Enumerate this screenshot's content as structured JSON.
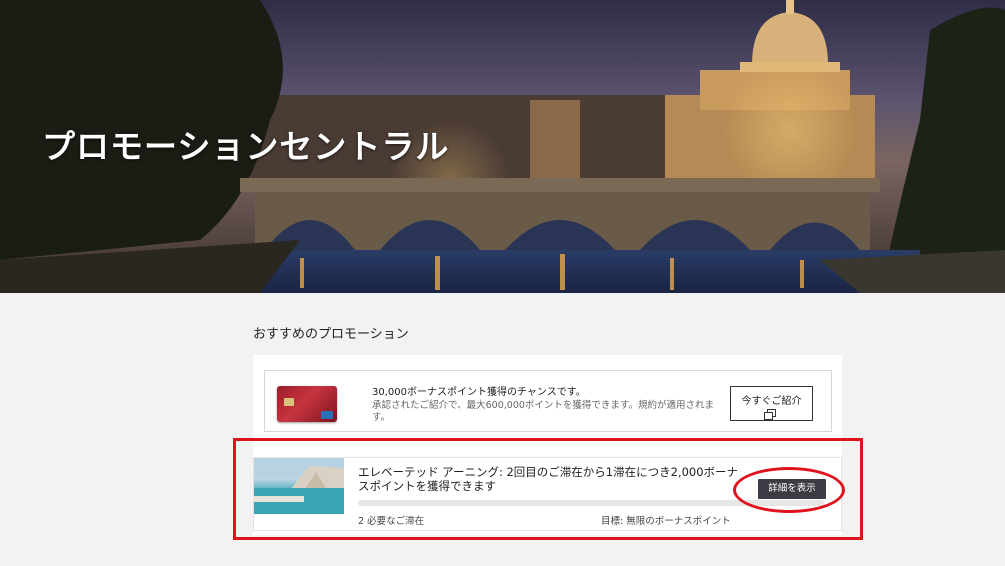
{
  "hero": {
    "title": "プロモーションセントラル"
  },
  "section": {
    "title": "おすすめのプロモーション"
  },
  "promotions": [
    {
      "title": "30,000ボーナスポイント獲得のチャンスです。",
      "description": "承認されたご紹介で、最大600,000ポイントを獲得できます。規約が適用されます。",
      "button_label": "今すぐご紹介",
      "button_icon": "external-link-icon"
    },
    {
      "title": "エレベーテッド アーニング: 2回目のご滞在から1滞在につき2,000ボーナスポイントを獲得できます",
      "progress": 0,
      "stays_required": "2 必要なご滞在",
      "goal": "目標: 無限のボーナスポイント",
      "button_label": "詳細を表示"
    }
  ],
  "annotations": {
    "highlight_color": "#e0121e"
  }
}
